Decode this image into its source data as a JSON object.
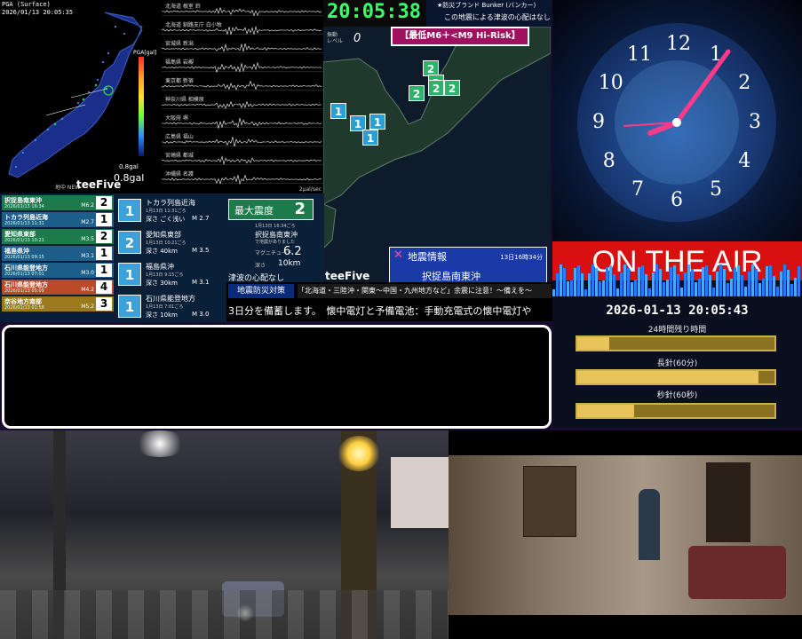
{
  "japan_map": {
    "header_title": "PGA (Surface)",
    "header_time": "2026/01/13 20:05:35",
    "legend_title": "PGA[gal]",
    "scale_value": "0.8gal",
    "small_value": "0.8gal",
    "brand": "teeFive",
    "brand_prefix": "地中 NEW"
  },
  "seismo": {
    "rows": [
      "北海道 根室 鈴",
      "北海道 釧路支庁 白小牧",
      "宮城県 新潟",
      "福島県 岩槻",
      "東京都 新宿",
      "神奈川県 相模原",
      "大阪府 堺",
      "広島県 福山",
      "宮崎県 都城",
      "沖縄県 名護"
    ],
    "scale": "2μal/sec"
  },
  "top_clock": {
    "time": "20:05:38",
    "ticker_top": "★防災ブランド Bunker (バンカー)",
    "ticker_sub": "この地震による津波の心配はなし"
  },
  "quake_map": {
    "level_label": "振動\nレベル",
    "level_value": "0",
    "risk_banner": "【最低M6＋<M9 Hi-Risk】",
    "brand": "teeFive",
    "markers": [
      {
        "value": "2",
        "color": "#2db36a"
      },
      {
        "value": "2",
        "color": "#2db36a"
      },
      {
        "value": "2",
        "color": "#2db36a"
      },
      {
        "value": "2",
        "color": "#2db36a"
      },
      {
        "value": "2",
        "color": "#2db36a"
      },
      {
        "value": "1",
        "color": "#2b9ed4"
      },
      {
        "value": "1",
        "color": "#2b9ed4"
      },
      {
        "value": "1",
        "color": "#2b9ed4"
      },
      {
        "value": "1",
        "color": "#2b9ed4"
      }
    ]
  },
  "eq_info": {
    "title": "地震情報",
    "date": "13日16時34分",
    "location": "択捉島南東沖"
  },
  "eq_list": [
    {
      "name": "択捉島南東沖",
      "date": "2026/01/13 16:34",
      "mag": "M6.2",
      "int": "2",
      "color": "#1d7a4a"
    },
    {
      "name": "トカラ列島近海",
      "date": "2026/01/13 11:31",
      "mag": "M2.7",
      "int": "1",
      "color": "#1d5e8a"
    },
    {
      "name": "愛知県東部",
      "date": "2026/01/13 10:21",
      "mag": "M3.5",
      "int": "2",
      "color": "#1d7a4a"
    },
    {
      "name": "福島県沖",
      "date": "2026/01/13 09:15",
      "mag": "M3.1",
      "int": "1",
      "color": "#1d5e8a"
    },
    {
      "name": "石川県能登地方",
      "date": "2026/01/13 07:01",
      "mag": "M3.0",
      "int": "1",
      "color": "#1d5e8a"
    },
    {
      "name": "石川県能登地方",
      "date": "2026/01/13 05:09",
      "mag": "M4.2",
      "int": "4",
      "color": "#b84a2a"
    },
    {
      "name": "奈谷地方南部",
      "date": "2026/01/13 01:58",
      "mag": "M5.2",
      "int": "3",
      "color": "#9a7a1a"
    }
  ],
  "eq_detail": [
    {
      "int": "1",
      "name": "トカラ列島近海",
      "time": "1月13日 11:31ごろ",
      "depth": "深さ ごく浅い",
      "mag": "M 2.7"
    },
    {
      "int": "2",
      "name": "愛知県東部",
      "time": "1月13日 10:21ごろ",
      "depth": "深さ 40km",
      "mag": "M 3.5"
    },
    {
      "int": "1",
      "name": "福島県沖",
      "time": "1月13日 9:15ごろ",
      "depth": "深さ 30km",
      "mag": "M 3.1"
    },
    {
      "int": "1",
      "name": "石川県能登地方",
      "time": "1月13日 7:01ごろ",
      "depth": "深さ 10km",
      "mag": "M 3.0"
    }
  ],
  "info_block": {
    "max_label": "最大震度",
    "max_value": "2",
    "time": "1月13日 16:34ごろ",
    "place": "択捉島南東沖",
    "place_sub": "で地震がありました",
    "mag_label": "マグニチュード",
    "mag_value": "6.2",
    "depth_label": "深さ",
    "depth_value": "10km",
    "tsunami": "津波の心配なし"
  },
  "ticker": {
    "tag": "地震防災対策",
    "headline": "「北海道・三陸沖・関東〜中国・九州地方など」余震に注意！〜備えを〜",
    "scroll": "3日分を備蓄します。　懐中電灯と予備電池：手動充電式の懐中電灯や"
  },
  "clock": {
    "numbers": [
      "12",
      "1",
      "2",
      "3",
      "4",
      "5",
      "6",
      "7",
      "8",
      "9",
      "10",
      "11"
    ]
  },
  "onair": {
    "banner": "ON THE AIR",
    "datetime": "2026-01-13 20:05:43",
    "bar1_label": "24時間残り時間",
    "bar1_progress": 0.16,
    "bar2_label": "長針(60分)",
    "bar2_progress": 0.92,
    "bar3_label": "秒針(60秒)",
    "bar3_progress": 0.29
  }
}
